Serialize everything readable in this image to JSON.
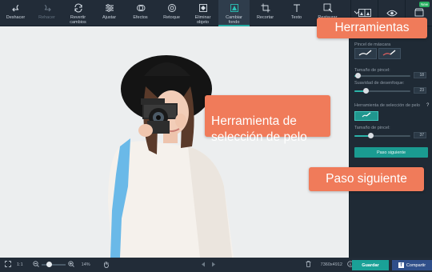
{
  "toolbar": {
    "tools": [
      {
        "label": "Deshacer",
        "icon": "undo-icon",
        "state": "normal"
      },
      {
        "label": "Rehacer",
        "icon": "redo-icon",
        "state": "disabled"
      },
      {
        "label": "Revertir\ncambios",
        "icon": "revert-icon",
        "state": "normal"
      },
      {
        "label": "Ajustar",
        "icon": "sliders-icon",
        "state": "normal"
      },
      {
        "label": "Efectos",
        "icon": "effects-icon",
        "state": "normal"
      },
      {
        "label": "Retoque",
        "icon": "retouch-icon",
        "state": "normal"
      },
      {
        "label": "Eliminar\nobjeto",
        "icon": "remove-object-icon",
        "state": "normal"
      },
      {
        "label": "Cambiar\nfondo",
        "icon": "change-background-icon",
        "state": "active"
      },
      {
        "label": "Recortar",
        "icon": "crop-icon",
        "state": "normal"
      },
      {
        "label": "Texto",
        "icon": "text-icon",
        "state": "normal"
      },
      {
        "label": "Restaurar",
        "icon": "restore-icon",
        "state": "normal"
      }
    ],
    "more_icon": "chevron-down-icon",
    "right_icons": [
      "compare-icon",
      "eye-icon",
      "store-icon"
    ],
    "new_badge": "New"
  },
  "panel": {
    "brush_label": "Pincel de máscara",
    "brush_size_label": "Tamaño de pincel:",
    "brush_size_value": "18",
    "brush_size_fraction": 0.05,
    "blur_label": "Suavidad de desenfoque:",
    "blur_value": "23",
    "blur_fraction": 0.2,
    "hair_tool_label": "Herramienta de selección de pelo",
    "hair_size_label": "Tamaño de pincel:",
    "hair_size_value": "37",
    "hair_size_fraction": 0.28,
    "help": "?",
    "next_button": "Paso siguiente"
  },
  "callouts": {
    "tools": "Herramientas",
    "hair": "Herramienta de\nselección de pelo",
    "next": "Paso siguiente"
  },
  "bottom": {
    "fit": "1:1",
    "zoom": "14%",
    "zoom_fraction": 0.2,
    "dimensions": "7360x4912",
    "save": "Guardar",
    "share": "Compartir"
  },
  "colors": {
    "accent": "#1aa197",
    "callout": "#f07b5a",
    "toolbar": "#222c38",
    "panel": "#1f2a35",
    "selection_mask": "#5bb3e8"
  }
}
